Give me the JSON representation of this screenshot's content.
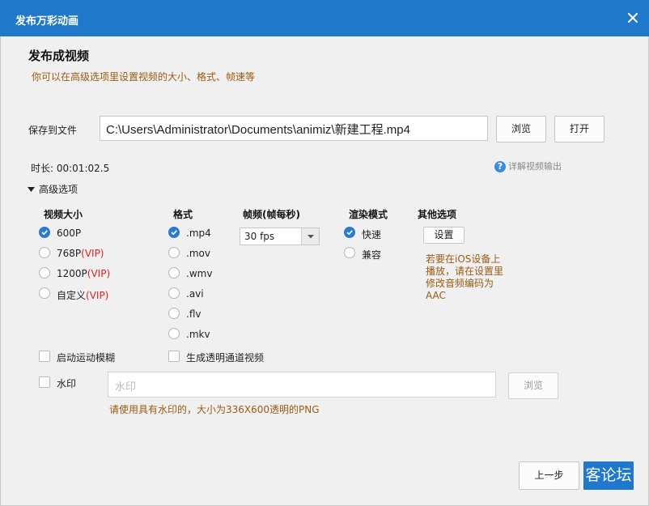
{
  "window": {
    "title": "发布万彩动画"
  },
  "page": {
    "heading": "发布成视频",
    "subtitle": "你可以在高级选项里设置视频的大小、格式、帧速等"
  },
  "save": {
    "label": "保存到文件",
    "path": "C:\\Users\\Administrator\\Documents\\animiz\\新建工程.mp4",
    "browse_label": "浏览",
    "open_label": "打开"
  },
  "duration": {
    "text": "时长: 00:01:02.5"
  },
  "help": {
    "text": "详解视频输出"
  },
  "advanced": {
    "label": "高级选项"
  },
  "video_size": {
    "header": "视频大小",
    "options": [
      {
        "label": "600P",
        "vip": "",
        "selected": true
      },
      {
        "label": "768P",
        "vip": "(VIP)",
        "selected": false
      },
      {
        "label": "1200P",
        "vip": "(VIP)",
        "selected": false
      },
      {
        "label": "自定义",
        "vip": "(VIP)",
        "selected": false
      }
    ]
  },
  "format": {
    "header": "格式",
    "options": [
      {
        "label": ".mp4",
        "selected": true
      },
      {
        "label": ".mov",
        "selected": false
      },
      {
        "label": ".wmv",
        "selected": false
      },
      {
        "label": ".avi",
        "selected": false
      },
      {
        "label": ".flv",
        "selected": false
      },
      {
        "label": ".mkv",
        "selected": false
      }
    ]
  },
  "frame_rate": {
    "header": "帧频(帧每秒)",
    "value": "30 fps"
  },
  "render_mode": {
    "header": "渲染模式",
    "options": [
      {
        "label": "快速",
        "selected": true
      },
      {
        "label": "兼容",
        "selected": false
      }
    ]
  },
  "other": {
    "header": "其他选项",
    "settings_label": "设置",
    "note": "若要在iOS设备上播放，请在设置里修改音频编码为AAC"
  },
  "checks": {
    "motion_blur": {
      "label": "启动运动模糊",
      "checked": false
    },
    "alpha_video": {
      "label": "生成透明通道视频",
      "checked": false
    },
    "watermark": {
      "label": "水印",
      "checked": false
    }
  },
  "watermark": {
    "placeholder": "水印",
    "browse_label": "浏览",
    "hint": "请使用具有水印的，大小为336X600透明的PNG"
  },
  "footer": {
    "prev_label": "上一步",
    "next_label": "客论坛"
  },
  "colors": {
    "accent": "#1f78c9",
    "note": "#9b5a14",
    "vip": "#e02020"
  }
}
